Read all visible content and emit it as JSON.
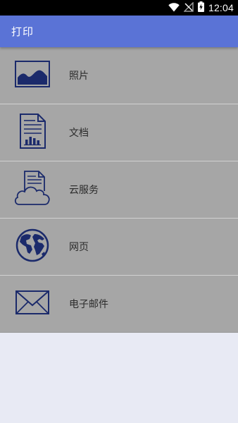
{
  "status_bar": {
    "time": "12:04",
    "icons": [
      "wifi-icon",
      "no-signal-icon",
      "battery-charging-icon"
    ]
  },
  "app_bar": {
    "title": "打印"
  },
  "menu": {
    "items": [
      {
        "label": "照片",
        "icon": "photo-icon"
      },
      {
        "label": "文档",
        "icon": "document-icon"
      },
      {
        "label": "云服务",
        "icon": "cloud-service-icon"
      },
      {
        "label": "网页",
        "icon": "globe-icon"
      },
      {
        "label": "电子邮件",
        "icon": "envelope-icon"
      }
    ]
  },
  "colors": {
    "app_bar": "#5a73d6",
    "menu_background": "#a6a6a6",
    "icon": "#1b2a6b",
    "page_background": "#e8eaf4"
  }
}
